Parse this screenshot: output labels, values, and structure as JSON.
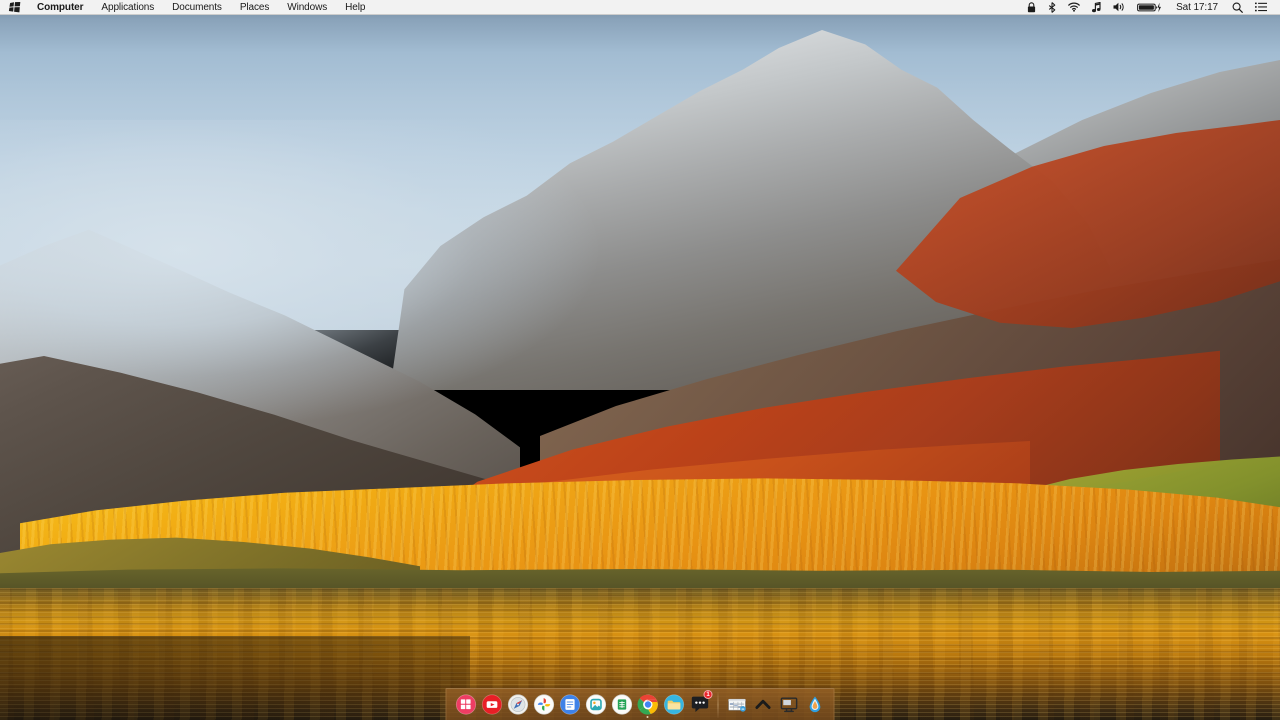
{
  "menubar": {
    "logo_icon": "windows-flag-logo",
    "items": [
      {
        "label": "Computer",
        "active": true,
        "name": "menu-computer"
      },
      {
        "label": "Applications",
        "active": false,
        "name": "menu-applications"
      },
      {
        "label": "Documents",
        "active": false,
        "name": "menu-documents"
      },
      {
        "label": "Places",
        "active": false,
        "name": "menu-places"
      },
      {
        "label": "Windows",
        "active": false,
        "name": "menu-windows"
      },
      {
        "label": "Help",
        "active": false,
        "name": "menu-help"
      }
    ],
    "status_icons": [
      {
        "name": "lock-icon",
        "glyph": "lock"
      },
      {
        "name": "bluetooth-icon",
        "glyph": "bluetooth"
      },
      {
        "name": "wifi-icon",
        "glyph": "wifi"
      },
      {
        "name": "music-note-icon",
        "glyph": "music"
      },
      {
        "name": "volume-icon",
        "glyph": "volume"
      },
      {
        "name": "battery-icon",
        "glyph": "battery-charging"
      }
    ],
    "clock": "Sat 17:17",
    "right_icons": [
      {
        "name": "spotlight-search-icon",
        "glyph": "search"
      },
      {
        "name": "notification-center-icon",
        "glyph": "list"
      }
    ]
  },
  "dock": {
    "background_color": "#966126",
    "apps": [
      {
        "name": "dock-item-start-menu",
        "label": "Start",
        "icon": "windows-start-icon",
        "running": false,
        "badge": null
      },
      {
        "name": "dock-item-youtube",
        "label": "YouTube",
        "icon": "youtube-icon",
        "running": false,
        "badge": null
      },
      {
        "name": "dock-item-compass",
        "label": "Maps",
        "icon": "compass-icon",
        "running": false,
        "badge": null
      },
      {
        "name": "dock-item-photos",
        "label": "Photos",
        "icon": "pinwheel-icon",
        "running": false,
        "badge": null
      },
      {
        "name": "dock-item-docs",
        "label": "Docs",
        "icon": "blue-document-icon",
        "running": false,
        "badge": null
      },
      {
        "name": "dock-item-gallery",
        "label": "Gallery",
        "icon": "teal-photo-icon",
        "running": false,
        "badge": null
      },
      {
        "name": "dock-item-sheets",
        "label": "Sheets",
        "icon": "green-sheet-icon",
        "running": false,
        "badge": null
      },
      {
        "name": "dock-item-chrome",
        "label": "Chrome",
        "icon": "chrome-icon",
        "running": true,
        "badge": null
      },
      {
        "name": "dock-item-files",
        "label": "Files",
        "icon": "blue-folder-icon",
        "running": false,
        "badge": null
      },
      {
        "name": "dock-item-messages",
        "label": "Messages",
        "icon": "chat-bubble-icon",
        "running": false,
        "badge": "1"
      }
    ],
    "tray": [
      {
        "name": "dock-item-minimized-window",
        "label": "Document",
        "icon": "window-thumbnail-icon"
      },
      {
        "name": "dock-item-show-desktop",
        "label": "Show Up",
        "icon": "chevron-up-icon"
      },
      {
        "name": "dock-item-display",
        "label": "Display",
        "icon": "monitor-icon"
      },
      {
        "name": "dock-item-water-drop",
        "label": "Water Drop",
        "icon": "water-drop-icon"
      }
    ]
  },
  "desktop": {
    "wallpaper_name": "autumn-mountain-lake",
    "sky_color": "#b0c7da",
    "foliage_gold": "#f0b120",
    "foliage_orange": "#c94c1c",
    "water_color": "#d89212"
  }
}
